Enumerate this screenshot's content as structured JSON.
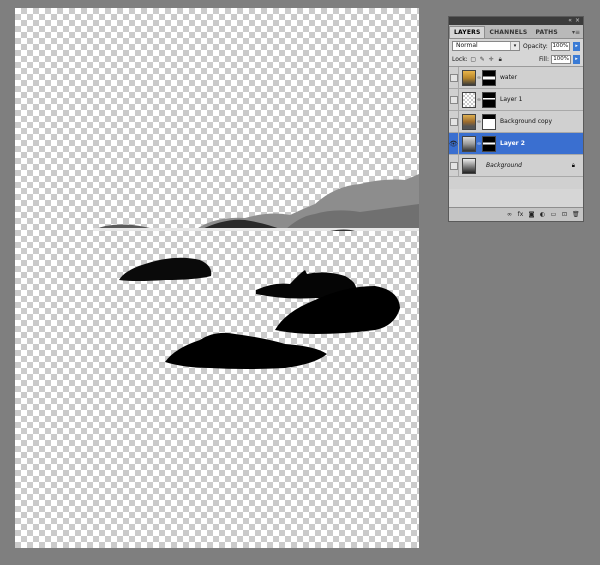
{
  "panel": {
    "tabs": [
      "LAYERS",
      "CHANNELS",
      "PATHS"
    ],
    "blend_mode": "Normal",
    "opacity_label": "Opacity:",
    "opacity_value": "100%",
    "fill_label": "Fill:",
    "fill_value": "100%",
    "lock_label": "Lock:",
    "layers": [
      {
        "name": "water",
        "selected": false,
        "visible": false
      },
      {
        "name": "Layer 1",
        "selected": false,
        "visible": false
      },
      {
        "name": "Background copy",
        "selected": false,
        "visible": false
      },
      {
        "name": "Layer 2",
        "selected": true,
        "visible": true
      },
      {
        "name": "Background",
        "selected": false,
        "visible": false,
        "locked": true
      }
    ]
  },
  "icons": {
    "collapse": "double-chevron-icon",
    "close": "close-icon",
    "menu": "panel-menu-icon",
    "eye": "eye-icon",
    "link": "chain-link-icon",
    "lock": "lock-icon"
  },
  "colors": {
    "workspace": "#7f7f7f",
    "selection": "#3a6fd0"
  }
}
